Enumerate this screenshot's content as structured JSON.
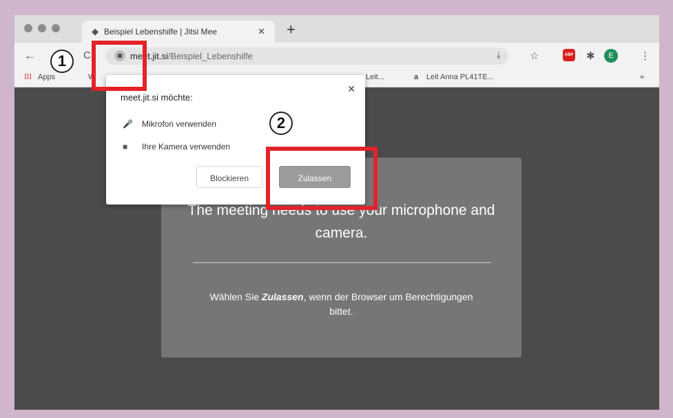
{
  "browser": {
    "tab_title": "Beispiel Lebenshilfe | Jitsi Mee",
    "tab_close": "✕",
    "new_tab": "+",
    "url_host": "meet.jit.si",
    "url_path": "/Beispiel_Lebenshilfe",
    "back": "←",
    "reload": "C",
    "star": "☆",
    "puzzle": "✱",
    "abp": "ABP",
    "avatar_letter": "E",
    "menu": "⋮",
    "download": "⤓"
  },
  "bookmarks": {
    "apps": "Apps",
    "w": "W",
    "leit": "Leit...",
    "leit_anna_icon": "a",
    "leit_anna": "Leit Anna PL41TE...",
    "more": "»"
  },
  "popup": {
    "title": "meet.jit.si möchte:",
    "close": "✕",
    "permissions": [
      {
        "icon": "🎤",
        "label": "Mikrofon verwenden"
      },
      {
        "icon": "■",
        "label": "Ihre Kamera verwenden"
      }
    ],
    "block_label": "Blockieren",
    "allow_label": "Zulassen"
  },
  "card": {
    "heading": "The meeting needs to use your microphone and camera.",
    "sub_prefix": "Wählen Sie ",
    "sub_emph": "Zulassen",
    "sub_suffix": ", wenn der Browser um Berechtigungen bittet."
  },
  "annotations": {
    "marker_1": "1",
    "marker_2": "2",
    "highlight_color": "#e2232a"
  }
}
